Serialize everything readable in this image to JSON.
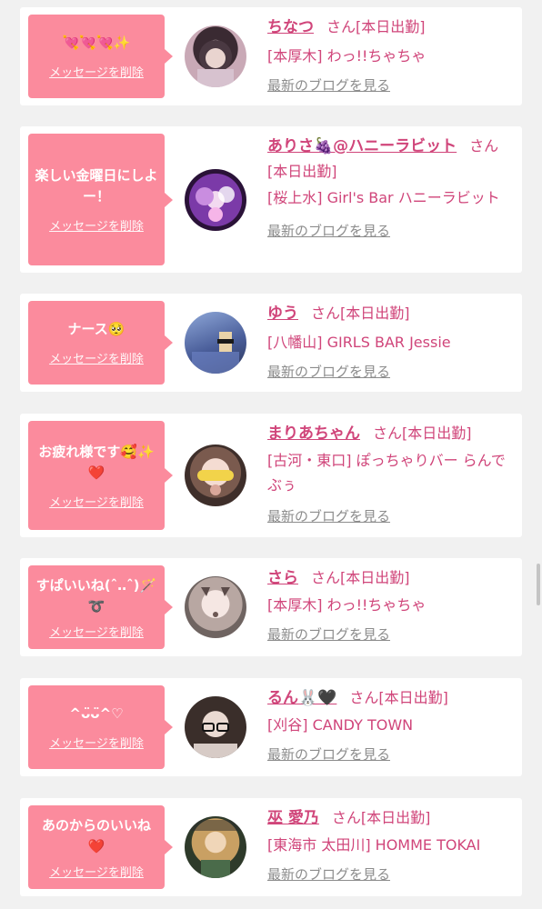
{
  "colors": {
    "accent": "#d0457a",
    "bubble": "#fb8b9d",
    "link_gray": "#8c8c8c",
    "background": "#f1f1f1"
  },
  "items": [
    {
      "message": "💘💘💘✨",
      "delete_label": "メッセージを削除",
      "name": "ちなつ",
      "suffix": "さん[本日出勤]",
      "shop": "[本厚木] わっ!!ちゃちゃ",
      "blog_label": "最新のブログを見る"
    },
    {
      "message": "楽しい金曜日にしよー！",
      "delete_label": "メッセージを削除",
      "name": "ありさ🍇@ハニーラビット",
      "suffix": "さん[本日出勤]",
      "shop": "[桜上水] Girl's Bar ハニーラビット",
      "blog_label": "最新のブログを見る"
    },
    {
      "message": "ナース🥺",
      "delete_label": "メッセージを削除",
      "name": "ゆう",
      "suffix": "さん[本日出勤]",
      "shop": "[八幡山] GIRLS BAR Jessie",
      "blog_label": "最新のブログを見る"
    },
    {
      "message": "お疲れ様です🥰✨❤️",
      "delete_label": "メッセージを削除",
      "name": "まりあちゃん",
      "suffix": "さん[本日出勤]",
      "shop": "[古河・東口] ぽっちゃりバー らんでぶぅ",
      "blog_label": "最新のブログを見る"
    },
    {
      "message": "すぱいいね(ˆ‥ˆ)🪄➰",
      "delete_label": "メッセージを削除",
      "name": "さら",
      "suffix": "さん[本日出勤]",
      "shop": "[本厚木] わっ!!ちゃちゃ",
      "blog_label": "最新のブログを見る"
    },
    {
      "message": "^ᴗ̈ᴗ̈^♡",
      "delete_label": "メッセージを削除",
      "name": "るん🐰🖤",
      "suffix": "さん[本日出勤]",
      "shop": "[刈谷] CANDY TOWN",
      "blog_label": "最新のブログを見る"
    },
    {
      "message": "あのからのいいね❤️",
      "delete_label": "メッセージを削除",
      "name": "巫 愛乃",
      "suffix": "さん[本日出勤]",
      "shop": "[東海市 太田川] HOMME TOKAI",
      "blog_label": "最新のブログを見る"
    }
  ]
}
